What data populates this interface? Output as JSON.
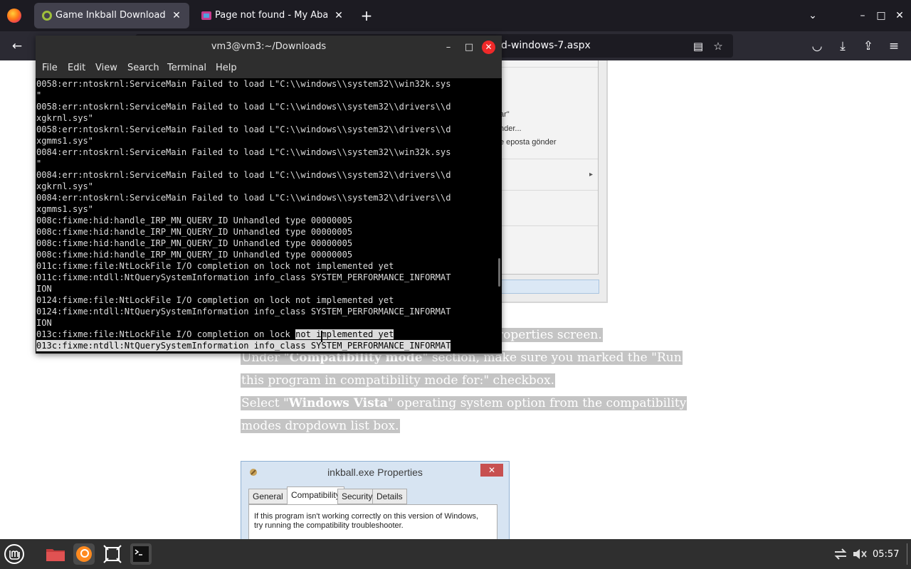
{
  "browser": {
    "tabs": [
      {
        "title": "Game Inkball Download for",
        "close": "✕"
      },
      {
        "title": "Page not found - My Aband",
        "close": "✕"
      }
    ],
    "new_tab": "+",
    "tab_list": "⌄",
    "window_controls": {
      "minimize": "–",
      "maximize": "□",
      "close": "✕"
    },
    "back": "←",
    "url_visible": "d-windows-7.aspx",
    "reader": "▤",
    "bookmark": "☆",
    "pocket": "◡",
    "download": "⤓",
    "extensions": "⇪",
    "menu": "≡"
  },
  "page": {
    "context_menu_fragments": [
      "ar\"",
      "nder...",
      "e eposta gönder"
    ],
    "submenu_arrow": "▸",
    "article": {
      "line1_visible": "roperties screen.",
      "line2_a": "Under \"",
      "line2_b": "Compatibility mode",
      "line2_c": "\" section, make sure you marked the \"Run",
      "line3": "this program in compatibility mode for:\" checkbox.",
      "line4_a": "Select \"",
      "line4_b": "Windows Vista",
      "line4_c": "\" operating system option from the compatibility",
      "line5": "modes dropdown list box."
    },
    "properties_dialog": {
      "title": "inkball.exe Properties",
      "close": "✕",
      "tabs": [
        "General",
        "Compatibility",
        "Security",
        "Details"
      ],
      "text_line1": "If this program isn't working correctly on this version of Windows,",
      "text_line2": "try running the compatibility troubleshooter."
    }
  },
  "terminal": {
    "title": "vm3@vm3:~/Downloads",
    "buttons": {
      "minimize": "–",
      "maximize": "□",
      "close": "✕"
    },
    "menu": [
      "File",
      "Edit",
      "View",
      "Search",
      "Terminal",
      "Help"
    ],
    "lines": [
      "0058:err:ntoskrnl:ServiceMain Failed to load L\"C:\\\\windows\\\\system32\\\\win32k.sys",
      "\"",
      "0058:err:ntoskrnl:ServiceMain Failed to load L\"C:\\\\windows\\\\system32\\\\drivers\\\\d",
      "xgkrnl.sys\"",
      "0058:err:ntoskrnl:ServiceMain Failed to load L\"C:\\\\windows\\\\system32\\\\drivers\\\\d",
      "xgmms1.sys\"",
      "0084:err:ntoskrnl:ServiceMain Failed to load L\"C:\\\\windows\\\\system32\\\\win32k.sys",
      "\"",
      "0084:err:ntoskrnl:ServiceMain Failed to load L\"C:\\\\windows\\\\system32\\\\drivers\\\\d",
      "xgkrnl.sys\"",
      "0084:err:ntoskrnl:ServiceMain Failed to load L\"C:\\\\windows\\\\system32\\\\drivers\\\\d",
      "xgmms1.sys\"",
      "008c:fixme:hid:handle_IRP_MN_QUERY_ID Unhandled type 00000005",
      "008c:fixme:hid:handle_IRP_MN_QUERY_ID Unhandled type 00000005",
      "008c:fixme:hid:handle_IRP_MN_QUERY_ID Unhandled type 00000005",
      "008c:fixme:hid:handle_IRP_MN_QUERY_ID Unhandled type 00000005",
      "011c:fixme:file:NtLockFile I/O completion on lock not implemented yet",
      "011c:fixme:ntdll:NtQuerySystemInformation info_class SYSTEM_PERFORMANCE_INFORMAT",
      "ION",
      "0124:fixme:file:NtLockFile I/O completion on lock not implemented yet",
      "0124:fixme:ntdll:NtQuerySystemInformation info_class SYSTEM_PERFORMANCE_INFORMAT",
      "ION"
    ],
    "line_sel_start": "013c:fixme:file:NtLockFile I/O completion on lock ",
    "line_sel_end": "not implemented yet",
    "line_last": "013c:fixme:ntdll:NtQuerySystemInformation info_class SYSTEM_PERFORMANCE_INFORMAT"
  },
  "taskbar": {
    "clock": "05:57"
  },
  "colors": {
    "firefox_dark": "#1c1b22",
    "firefox_toolbar": "#2b2a33",
    "terminal_bg": "#000000",
    "selection_gray": "#c4c4c4",
    "close_red": "#ef2929"
  }
}
